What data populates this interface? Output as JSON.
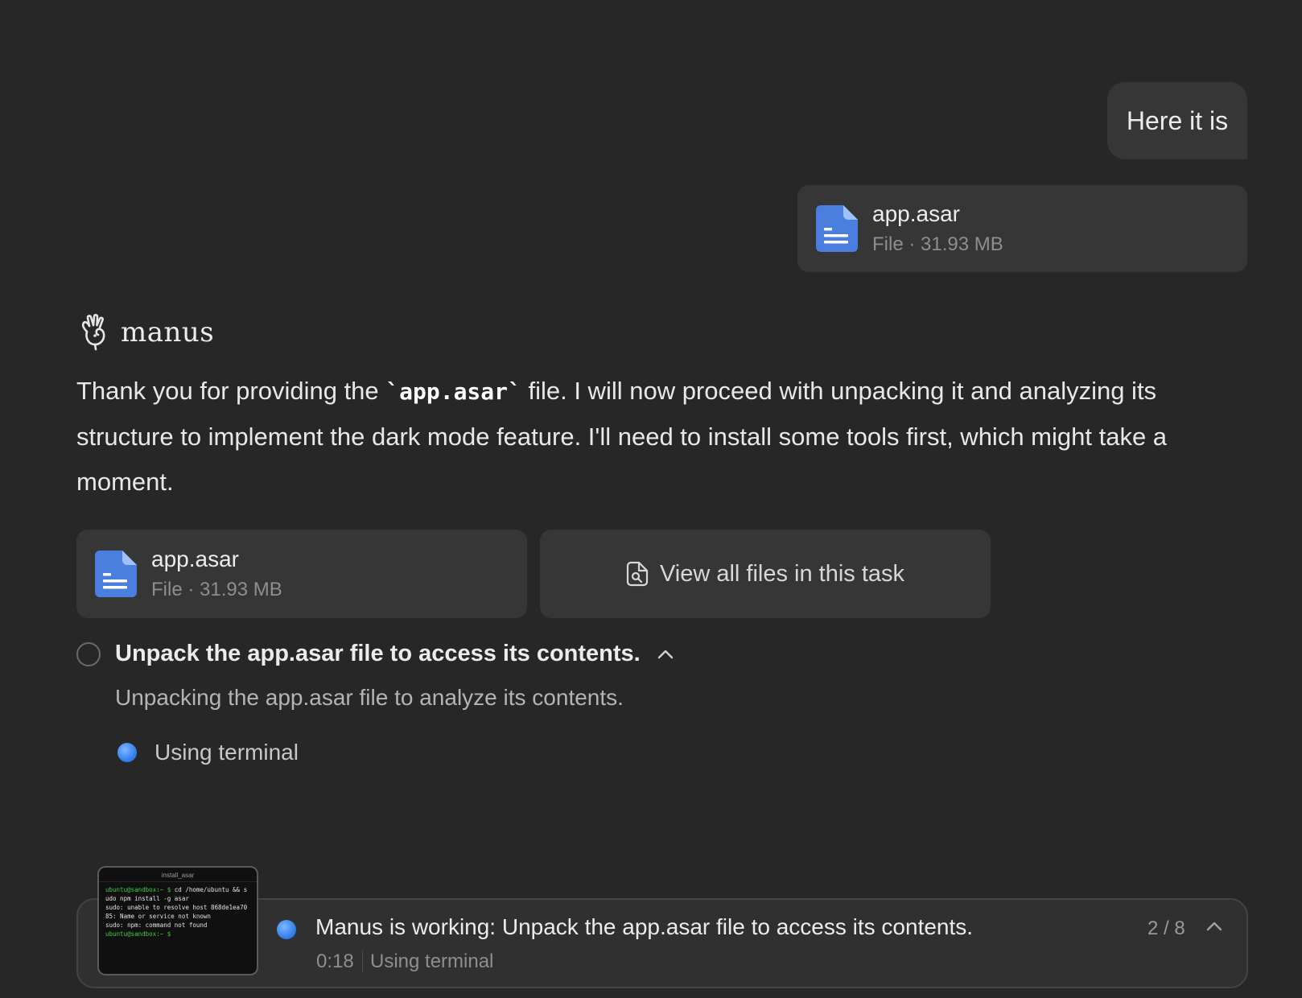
{
  "user_message": {
    "text": "Here it is",
    "attachment": {
      "name": "app.asar",
      "meta": "File · 31.93 MB",
      "icon": "document-icon"
    }
  },
  "assistant": {
    "brand_name": "manus",
    "brand_icon": "manus-hand-icon",
    "message_before": "Thank you for providing the ",
    "message_code": "`app.asar`",
    "message_after": " file. I will now proceed with unpacking it and analyzing its structure to implement the dark mode feature. I'll need to install some tools first, which might take a moment.",
    "attachment": {
      "name": "app.asar",
      "meta": "File · 31.93 MB",
      "icon": "document-icon"
    },
    "view_all_label": "View all files in this task",
    "view_all_icon": "file-search-icon"
  },
  "step": {
    "title": "Unpack the app.asar file to access its contents.",
    "description": "Unpacking the app.asar file to analyze its contents.",
    "tool_label": "Using terminal"
  },
  "status": {
    "thumbnail_title": "install_asar",
    "terminal_lines": [
      {
        "prompt": "ubuntu@sandbox:~ $",
        "text": " cd /home/ubuntu && s"
      },
      {
        "prompt": "",
        "text": "udo npm install -g asar"
      },
      {
        "prompt": "",
        "text": "sudo: unable to resolve host 868de1ea70"
      },
      {
        "prompt": "",
        "text": "85: Name or service not known"
      },
      {
        "prompt": "",
        "text": "sudo: npm: command not found"
      },
      {
        "prompt": "ubuntu@sandbox:~ $",
        "text": ""
      }
    ],
    "title": "Manus is working: Unpack the app.asar file to access its contents.",
    "elapsed": "0:18",
    "tool": "Using terminal",
    "progress": "2 / 8"
  },
  "colors": {
    "background": "#272727",
    "card": "#363636",
    "file_icon": "#4a7fe0",
    "active_dot": "#3b86f0"
  }
}
